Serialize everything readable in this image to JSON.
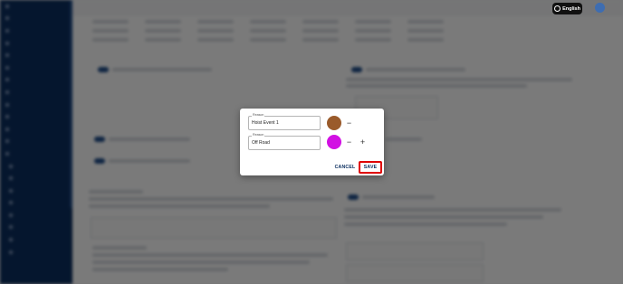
{
  "modal": {
    "field_1": {
      "label": "Reason",
      "value": "Hoist Event 1",
      "color": "#9a5b2b"
    },
    "field_2": {
      "label": "Reason",
      "value": "Off Road",
      "color": "#d210e3"
    },
    "remove_symbol": "−",
    "add_symbol": "+",
    "cancel_label": "CANCEL",
    "save_label": "SAVE"
  },
  "header": {
    "language_label": "English"
  },
  "colors": {
    "sidebar": "#0c2f60",
    "highlight": "#e00000",
    "accent": "#0c2f60"
  }
}
